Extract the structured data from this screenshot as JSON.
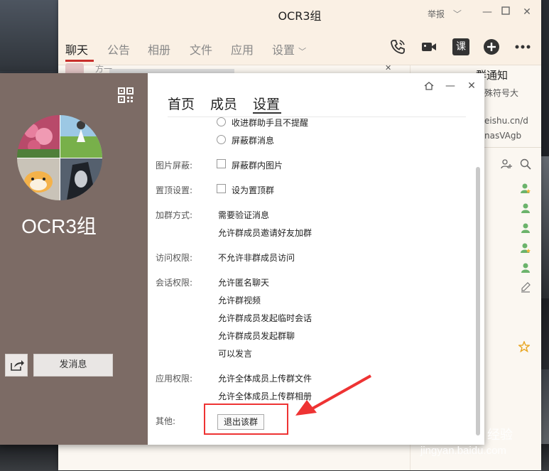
{
  "window": {
    "title": "OCR3组",
    "report": "举报"
  },
  "main_tabs": [
    {
      "label": "聊天"
    },
    {
      "label": "公告"
    },
    {
      "label": "相册"
    },
    {
      "label": "文件"
    },
    {
      "label": "应用"
    },
    {
      "label": "设置"
    }
  ],
  "right_panel": {
    "partial_texts": [
      "群通知",
      "殊符号大",
      "eishu.cn/d",
      "nasVAgb"
    ]
  },
  "chat_preview_partial": "方一",
  "dialog": {
    "tabs": [
      {
        "label": "首页"
      },
      {
        "label": "成员"
      },
      {
        "label": "设置"
      }
    ],
    "group_name": "OCR3组",
    "send_message_button": "发消息",
    "settings": {
      "top_options": [
        {
          "label": "收进群助手且不提醒",
          "type": "radio"
        },
        {
          "label": "屏蔽群消息",
          "type": "radio"
        }
      ],
      "image_block": {
        "label": "图片屏蔽:",
        "option": "屏蔽群内图片"
      },
      "pin": {
        "label": "置顶设置:",
        "option": "设为置顶群"
      },
      "join_method": {
        "label": "加群方式:",
        "items": [
          "需要验证消息",
          "允许群成员邀请好友加群"
        ]
      },
      "access": {
        "label": "访问权限:",
        "items": [
          "不允许非群成员访问"
        ]
      },
      "session": {
        "label": "会话权限:",
        "items": [
          "允许匿名聊天",
          "允许群视频",
          "允许群成员发起临时会话",
          "允许群成员发起群聊",
          "可以发言"
        ]
      },
      "app_perm": {
        "label": "应用权限:",
        "items": [
          "允许全体成员上传群文件",
          "允许全体成员上传群相册"
        ]
      },
      "other": {
        "label": "其他:",
        "quit_button": "退出该群"
      }
    }
  },
  "watermark": {
    "logo": "Baidu",
    "jingyan": "经验",
    "url": "jingyan.baidu.com"
  },
  "colors": {
    "accent_red": "#c9302c",
    "dialog_sidebar": "#7c6b65",
    "highlight": "#ee3333"
  },
  "icons": [
    "phone-icon",
    "video-icon",
    "course-icon",
    "plus-circle-icon",
    "more-icon",
    "qr-code-icon",
    "share-icon",
    "home-icon",
    "minimize-icon",
    "close-icon"
  ]
}
